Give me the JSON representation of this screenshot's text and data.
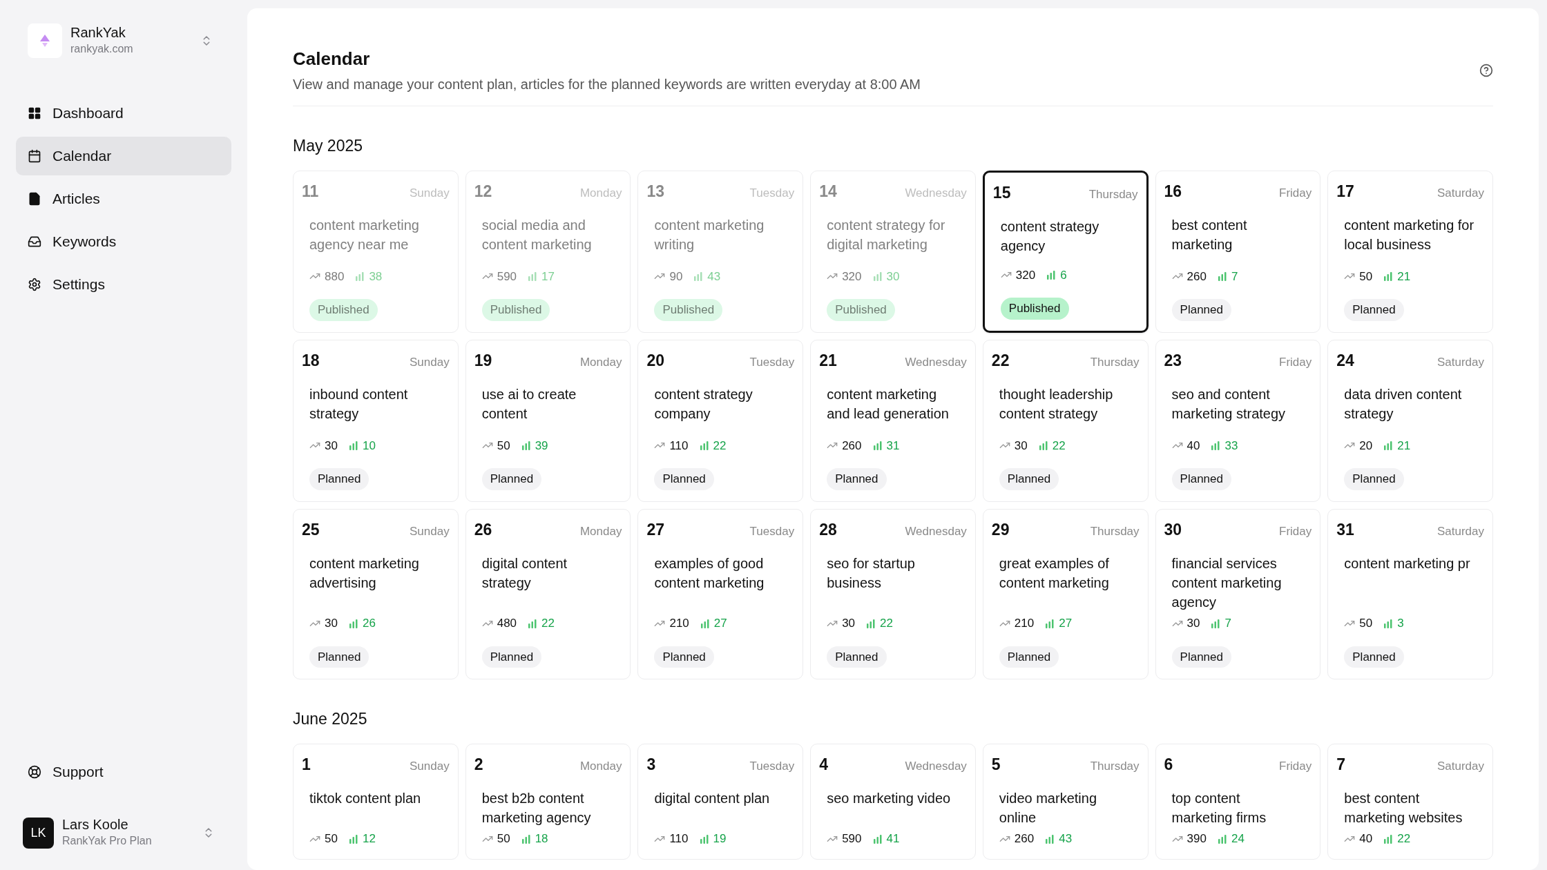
{
  "workspace": {
    "name": "RankYak",
    "domain": "rankyak.com"
  },
  "nav": [
    {
      "label": "Dashboard",
      "selected": false
    },
    {
      "label": "Calendar",
      "selected": true
    },
    {
      "label": "Articles",
      "selected": false
    },
    {
      "label": "Keywords",
      "selected": false
    },
    {
      "label": "Settings",
      "selected": false
    }
  ],
  "support": {
    "label": "Support"
  },
  "user": {
    "initials": "LK",
    "name": "Lars Koole",
    "plan": "RankYak Pro Plan"
  },
  "header": {
    "title": "Calendar",
    "subtitle": "View and manage your content plan, articles for the planned keywords are written everyday at 8:00 AM"
  },
  "months": [
    {
      "title": "May 2025",
      "days": [
        {
          "day": "11",
          "weekday": "Sunday",
          "keyword": "content marketing agency near me",
          "volume": "880",
          "difficulty": "38",
          "status": {
            "label": "Published",
            "kind": "published"
          },
          "past": true,
          "selected": false
        },
        {
          "day": "12",
          "weekday": "Monday",
          "keyword": "social media and content marketing",
          "volume": "590",
          "difficulty": "17",
          "status": {
            "label": "Published",
            "kind": "published"
          },
          "past": true,
          "selected": false
        },
        {
          "day": "13",
          "weekday": "Tuesday",
          "keyword": "content marketing writing",
          "volume": "90",
          "difficulty": "43",
          "status": {
            "label": "Published",
            "kind": "published"
          },
          "past": true,
          "selected": false
        },
        {
          "day": "14",
          "weekday": "Wednesday",
          "keyword": "content strategy for digital marketing",
          "volume": "320",
          "difficulty": "30",
          "status": {
            "label": "Published",
            "kind": "published"
          },
          "past": true,
          "selected": false
        },
        {
          "day": "15",
          "weekday": "Thursday",
          "keyword": "content strategy agency",
          "volume": "320",
          "difficulty": "6",
          "status": {
            "label": "Published",
            "kind": "published"
          },
          "past": false,
          "selected": true
        },
        {
          "day": "16",
          "weekday": "Friday",
          "keyword": "best content marketing",
          "volume": "260",
          "difficulty": "7",
          "status": {
            "label": "Planned",
            "kind": "planned"
          },
          "past": false,
          "selected": false
        },
        {
          "day": "17",
          "weekday": "Saturday",
          "keyword": "content marketing for local business",
          "volume": "50",
          "difficulty": "21",
          "status": {
            "label": "Planned",
            "kind": "planned"
          },
          "past": false,
          "selected": false
        },
        {
          "day": "18",
          "weekday": "Sunday",
          "keyword": "inbound content strategy",
          "volume": "30",
          "difficulty": "10",
          "status": {
            "label": "Planned",
            "kind": "planned"
          },
          "past": false,
          "selected": false
        },
        {
          "day": "19",
          "weekday": "Monday",
          "keyword": "use ai to create content",
          "volume": "50",
          "difficulty": "39",
          "status": {
            "label": "Planned",
            "kind": "planned"
          },
          "past": false,
          "selected": false
        },
        {
          "day": "20",
          "weekday": "Tuesday",
          "keyword": "content strategy company",
          "volume": "110",
          "difficulty": "22",
          "status": {
            "label": "Planned",
            "kind": "planned"
          },
          "past": false,
          "selected": false
        },
        {
          "day": "21",
          "weekday": "Wednesday",
          "keyword": "content marketing and lead generation",
          "volume": "260",
          "difficulty": "31",
          "status": {
            "label": "Planned",
            "kind": "planned"
          },
          "past": false,
          "selected": false
        },
        {
          "day": "22",
          "weekday": "Thursday",
          "keyword": "thought leadership content strategy",
          "volume": "30",
          "difficulty": "22",
          "status": {
            "label": "Planned",
            "kind": "planned"
          },
          "past": false,
          "selected": false
        },
        {
          "day": "23",
          "weekday": "Friday",
          "keyword": "seo and content marketing strategy",
          "volume": "40",
          "difficulty": "33",
          "status": {
            "label": "Planned",
            "kind": "planned"
          },
          "past": false,
          "selected": false
        },
        {
          "day": "24",
          "weekday": "Saturday",
          "keyword": "data driven content strategy",
          "volume": "20",
          "difficulty": "21",
          "status": {
            "label": "Planned",
            "kind": "planned"
          },
          "past": false,
          "selected": false
        },
        {
          "day": "25",
          "weekday": "Sunday",
          "keyword": "content marketing advertising",
          "volume": "30",
          "difficulty": "26",
          "status": {
            "label": "Planned",
            "kind": "planned"
          },
          "past": false,
          "selected": false
        },
        {
          "day": "26",
          "weekday": "Monday",
          "keyword": "digital content strategy",
          "volume": "480",
          "difficulty": "22",
          "status": {
            "label": "Planned",
            "kind": "planned"
          },
          "past": false,
          "selected": false
        },
        {
          "day": "27",
          "weekday": "Tuesday",
          "keyword": "examples of good content marketing",
          "volume": "210",
          "difficulty": "27",
          "status": {
            "label": "Planned",
            "kind": "planned"
          },
          "past": false,
          "selected": false
        },
        {
          "day": "28",
          "weekday": "Wednesday",
          "keyword": "seo for startup business",
          "volume": "30",
          "difficulty": "22",
          "status": {
            "label": "Planned",
            "kind": "planned"
          },
          "past": false,
          "selected": false
        },
        {
          "day": "29",
          "weekday": "Thursday",
          "keyword": "great examples of content marketing",
          "volume": "210",
          "difficulty": "27",
          "status": {
            "label": "Planned",
            "kind": "planned"
          },
          "past": false,
          "selected": false
        },
        {
          "day": "30",
          "weekday": "Friday",
          "keyword": "financial services content marketing agency",
          "volume": "30",
          "difficulty": "7",
          "status": {
            "label": "Planned",
            "kind": "planned"
          },
          "past": false,
          "selected": false
        },
        {
          "day": "31",
          "weekday": "Saturday",
          "keyword": "content marketing pr",
          "volume": "50",
          "difficulty": "3",
          "status": {
            "label": "Planned",
            "kind": "planned"
          },
          "past": false,
          "selected": false
        }
      ]
    },
    {
      "title": "June 2025",
      "days": [
        {
          "day": "1",
          "weekday": "Sunday",
          "keyword": "tiktok content plan",
          "volume": "50",
          "difficulty": "12",
          "past": false,
          "selected": false
        },
        {
          "day": "2",
          "weekday": "Monday",
          "keyword": "best b2b content marketing agency",
          "volume": "50",
          "difficulty": "18",
          "past": false,
          "selected": false
        },
        {
          "day": "3",
          "weekday": "Tuesday",
          "keyword": "digital content plan",
          "volume": "110",
          "difficulty": "19",
          "past": false,
          "selected": false
        },
        {
          "day": "4",
          "weekday": "Wednesday",
          "keyword": "seo marketing video",
          "volume": "590",
          "difficulty": "41",
          "past": false,
          "selected": false
        },
        {
          "day": "5",
          "weekday": "Thursday",
          "keyword": "video marketing online",
          "volume": "260",
          "difficulty": "43",
          "past": false,
          "selected": false
        },
        {
          "day": "6",
          "weekday": "Friday",
          "keyword": "top content marketing firms",
          "volume": "390",
          "difficulty": "24",
          "past": false,
          "selected": false
        },
        {
          "day": "7",
          "weekday": "Saturday",
          "keyword": "best content marketing websites",
          "volume": "40",
          "difficulty": "22",
          "past": false,
          "selected": false
        }
      ]
    }
  ]
}
